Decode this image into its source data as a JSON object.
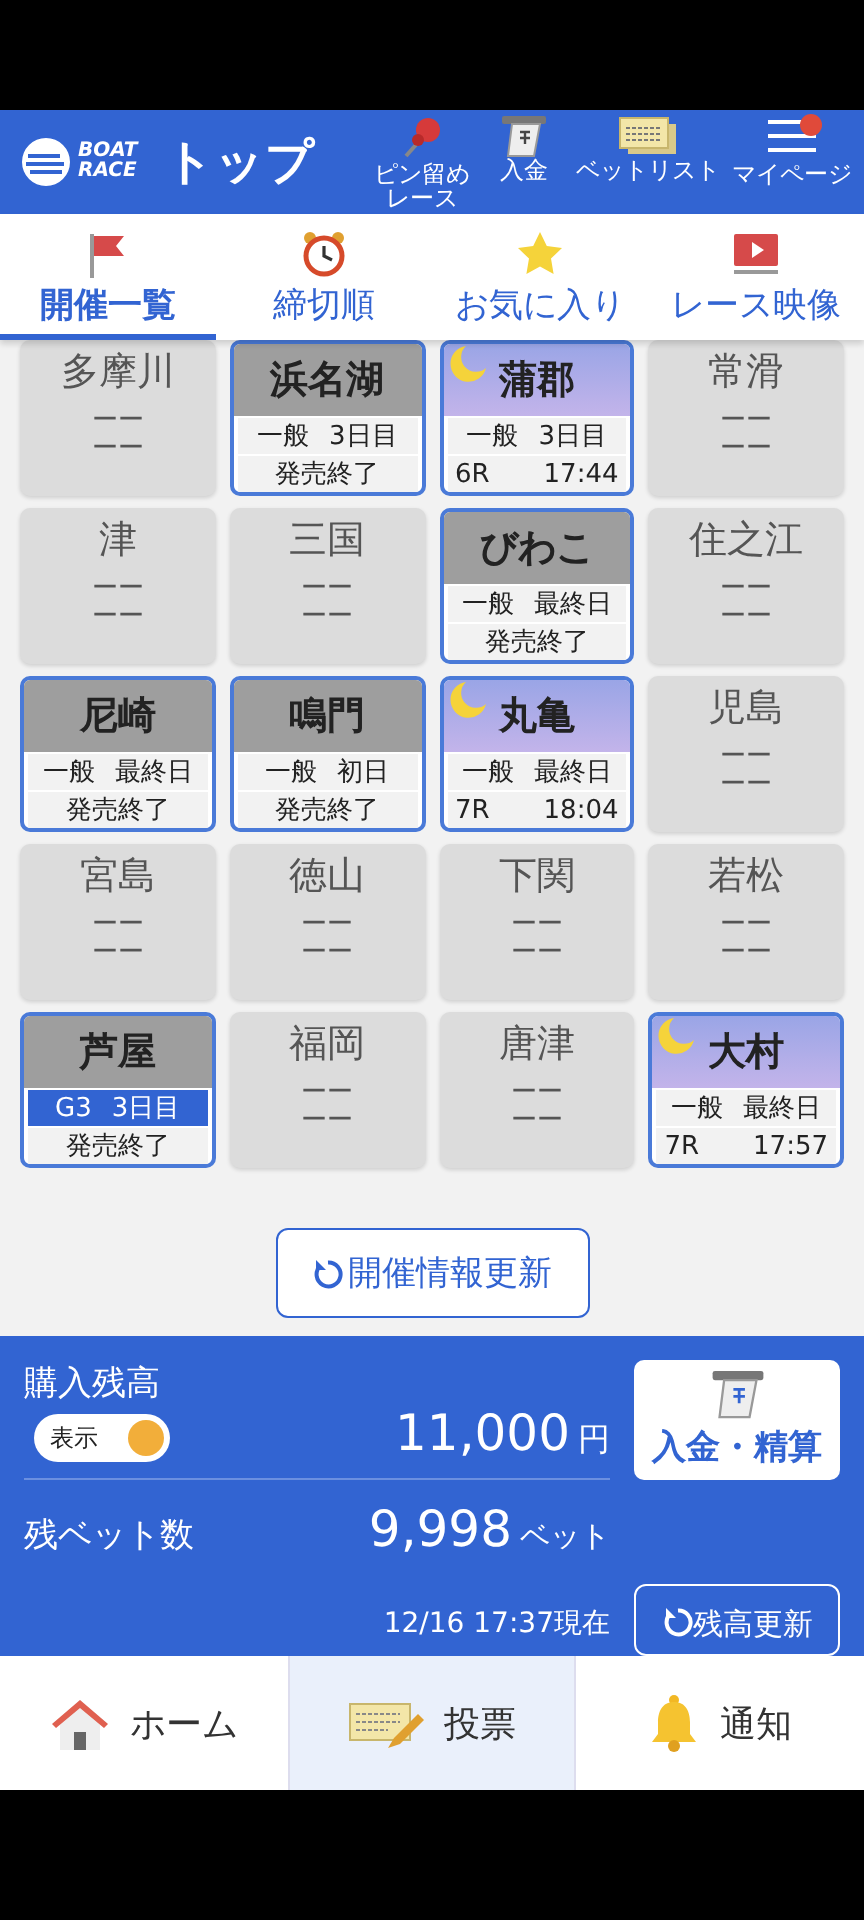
{
  "header": {
    "logo_lines": [
      "BOAT",
      "RACE"
    ],
    "title": "トップ",
    "actions": [
      {
        "kind": "pin",
        "label": "ピン留めレース"
      },
      {
        "kind": "deposit",
        "label": "入金"
      },
      {
        "kind": "betlist",
        "label": "ベットリスト"
      },
      {
        "kind": "menu",
        "label": "マイページ",
        "badge": true
      }
    ]
  },
  "tabs": [
    {
      "kind": "flag",
      "label": "開催一覧",
      "selected": true
    },
    {
      "kind": "clock",
      "label": "締切順",
      "selected": false
    },
    {
      "kind": "star",
      "label": "お気に入り",
      "selected": false
    },
    {
      "kind": "video",
      "label": "レース映像",
      "selected": false
    }
  ],
  "venues": [
    {
      "name": "多摩川",
      "kind": "closed",
      "row_1": [
        "ーー"
      ],
      "row_2": [
        "ーー"
      ]
    },
    {
      "name": "浜名湖",
      "kind": "open",
      "night": false,
      "highlight": false,
      "row_1": [
        "一般",
        "3日目"
      ],
      "row_2": [
        "発売終了"
      ]
    },
    {
      "name": "蒲郡",
      "kind": "open",
      "night": true,
      "highlight": false,
      "row_1": [
        "一般",
        "3日目"
      ],
      "row_2": [
        "6R",
        "17:44"
      ]
    },
    {
      "name": "常滑",
      "kind": "closed",
      "row_1": [
        "ーー"
      ],
      "row_2": [
        "ーー"
      ]
    },
    {
      "name": "津",
      "kind": "closed",
      "row_1": [
        "ーー"
      ],
      "row_2": [
        "ーー"
      ]
    },
    {
      "name": "三国",
      "kind": "closed",
      "row_1": [
        "ーー"
      ],
      "row_2": [
        "ーー"
      ]
    },
    {
      "name": "びわこ",
      "kind": "open",
      "night": false,
      "highlight": false,
      "row_1": [
        "一般",
        "最終日"
      ],
      "row_2": [
        "発売終了"
      ]
    },
    {
      "name": "住之江",
      "kind": "closed",
      "row_1": [
        "ーー"
      ],
      "row_2": [
        "ーー"
      ]
    },
    {
      "name": "尼崎",
      "kind": "open",
      "night": false,
      "highlight": false,
      "row_1": [
        "一般",
        "最終日"
      ],
      "row_2": [
        "発売終了"
      ]
    },
    {
      "name": "鳴門",
      "kind": "open",
      "night": false,
      "highlight": false,
      "row_1": [
        "一般",
        "初日"
      ],
      "row_2": [
        "発売終了"
      ]
    },
    {
      "name": "丸亀",
      "kind": "open",
      "night": true,
      "highlight": false,
      "row_1": [
        "一般",
        "最終日"
      ],
      "row_2": [
        "7R",
        "18:04"
      ]
    },
    {
      "name": "児島",
      "kind": "closed",
      "row_1": [
        "ーー"
      ],
      "row_2": [
        "ーー"
      ]
    },
    {
      "name": "宮島",
      "kind": "closed",
      "row_1": [
        "ーー"
      ],
      "row_2": [
        "ーー"
      ]
    },
    {
      "name": "徳山",
      "kind": "closed",
      "row_1": [
        "ーー"
      ],
      "row_2": [
        "ーー"
      ]
    },
    {
      "name": "下関",
      "kind": "closed",
      "row_1": [
        "ーー"
      ],
      "row_2": [
        "ーー"
      ]
    },
    {
      "name": "若松",
      "kind": "closed",
      "row_1": [
        "ーー"
      ],
      "row_2": [
        "ーー"
      ]
    },
    {
      "name": "芦屋",
      "kind": "open",
      "night": false,
      "highlight": true,
      "row_1": [
        "G3",
        "3日目"
      ],
      "row_2": [
        "発売終了"
      ]
    },
    {
      "name": "福岡",
      "kind": "closed",
      "row_1": [
        "ーー"
      ],
      "row_2": [
        "ーー"
      ]
    },
    {
      "name": "唐津",
      "kind": "closed",
      "row_1": [
        "ーー"
      ],
      "row_2": [
        "ーー"
      ]
    },
    {
      "name": "大村",
      "kind": "open",
      "night": true,
      "highlight": false,
      "row_1": [
        "一般",
        "最終日"
      ],
      "row_2": [
        "7R",
        "17:57"
      ]
    }
  ],
  "refresh_button": "開催情報更新",
  "balance": {
    "label": "購入残高",
    "toggle": {
      "label": "表示",
      "on": true
    },
    "amount": "11,000",
    "unit": "円",
    "bets_label": "残ベット数",
    "bets": "9,998",
    "bets_unit": "ベット",
    "updated": "12/16 17:37現在",
    "deposit_button": "入金・精算",
    "update_button": "残高更新"
  },
  "bottom_nav": [
    {
      "kind": "home",
      "label": "ホーム",
      "selected": false
    },
    {
      "kind": "vote",
      "label": "投票",
      "selected": true
    },
    {
      "kind": "bell",
      "label": "通知",
      "selected": false
    }
  ]
}
